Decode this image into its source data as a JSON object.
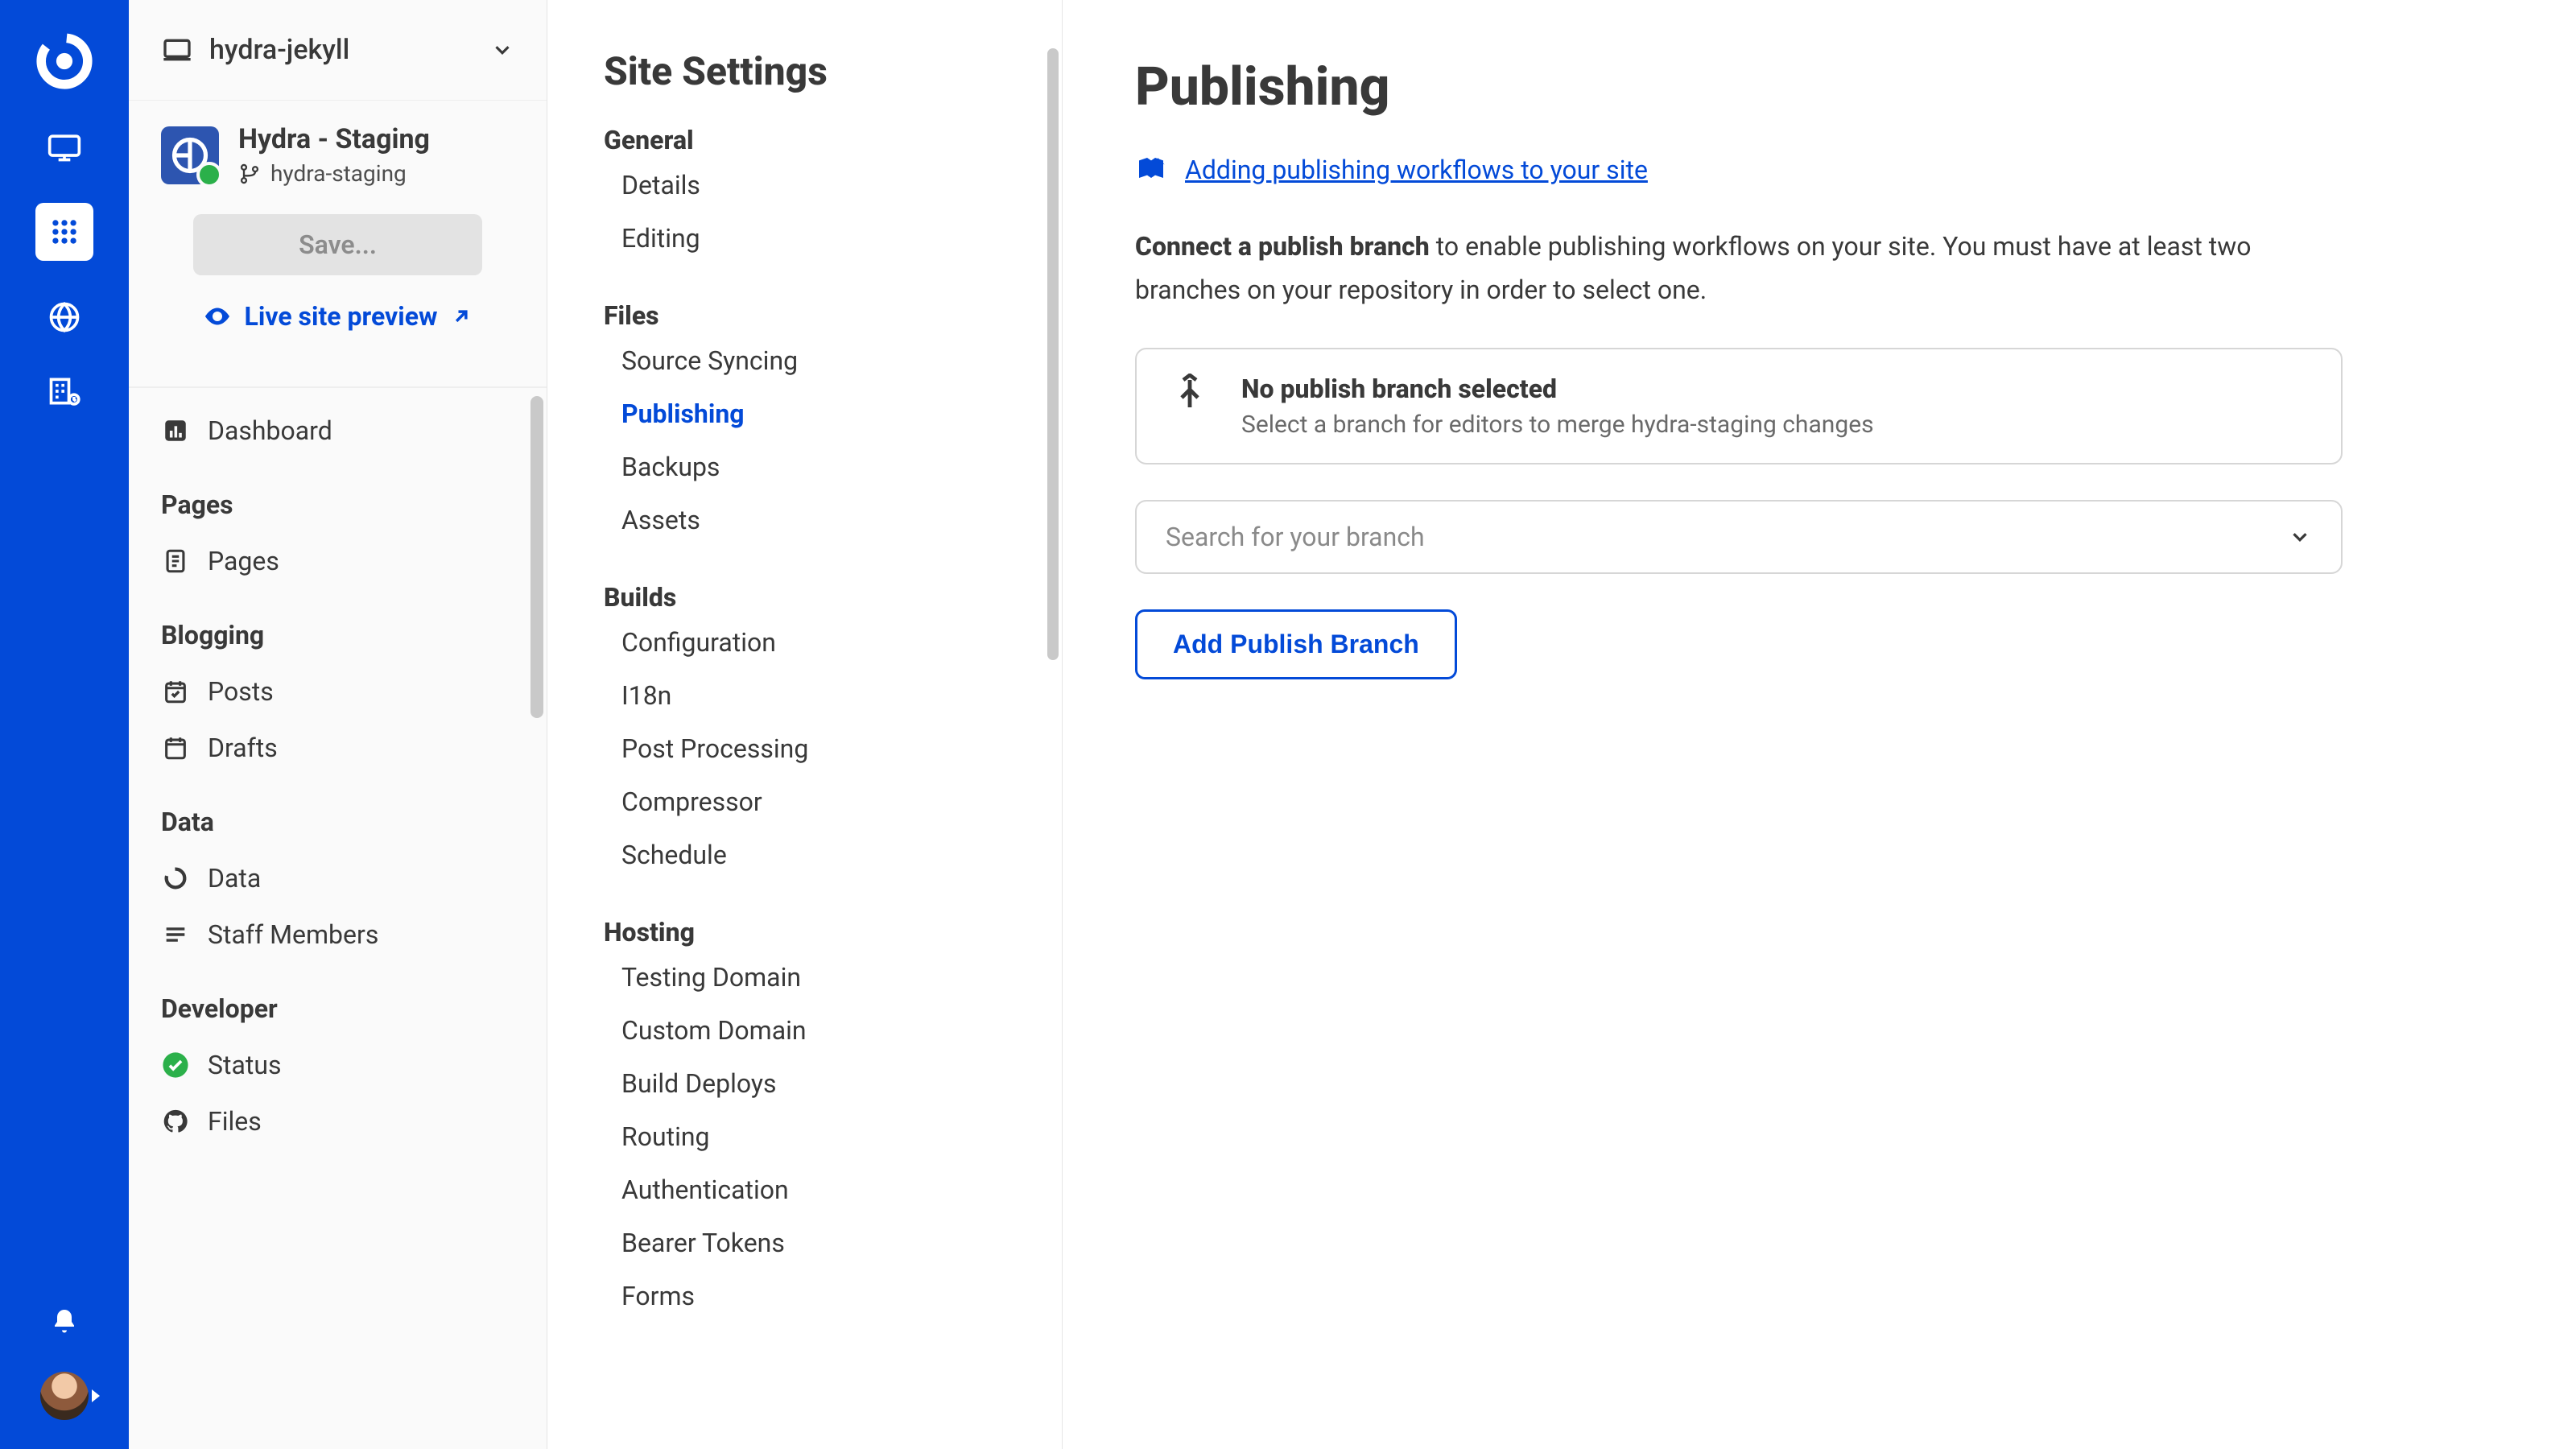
{
  "site_select": {
    "name": "hydra-jekyll"
  },
  "project": {
    "name": "Hydra - Staging",
    "branch": "hydra-staging"
  },
  "actions": {
    "save": "Save...",
    "preview": "Live site preview"
  },
  "sidenav": {
    "dashboard": "Dashboard",
    "groups": [
      {
        "h": "Pages",
        "items": [
          {
            "k": "pages",
            "l": "Pages"
          }
        ]
      },
      {
        "h": "Blogging",
        "items": [
          {
            "k": "posts",
            "l": "Posts"
          },
          {
            "k": "drafts",
            "l": "Drafts"
          }
        ]
      },
      {
        "h": "Data",
        "items": [
          {
            "k": "data",
            "l": "Data"
          },
          {
            "k": "staff",
            "l": "Staff Members"
          }
        ]
      },
      {
        "h": "Developer",
        "items": [
          {
            "k": "status",
            "l": "Status"
          },
          {
            "k": "files",
            "l": "Files"
          }
        ]
      }
    ]
  },
  "settings": {
    "title": "Site Settings",
    "groups": [
      {
        "h": "General",
        "items": [
          "Details",
          "Editing"
        ]
      },
      {
        "h": "Files",
        "items": [
          "Source Syncing",
          "Publishing",
          "Backups",
          "Assets"
        ],
        "active": "Publishing"
      },
      {
        "h": "Builds",
        "items": [
          "Configuration",
          "I18n",
          "Post Processing",
          "Compressor",
          "Schedule"
        ]
      },
      {
        "h": "Hosting",
        "items": [
          "Testing Domain",
          "Custom Domain",
          "Build Deploys",
          "Routing",
          "Authentication",
          "Bearer Tokens",
          "Forms"
        ]
      }
    ]
  },
  "main": {
    "title": "Publishing",
    "doc_link": "Adding publishing workflows to your site",
    "desc_bold": "Connect a publish branch",
    "desc_rest": " to enable publishing workflows on your site. You must have at least two branches on your repository in order to select one.",
    "card_title": "No publish branch selected",
    "card_sub": "Select a branch for editors to merge hydra-staging changes",
    "branch_placeholder": "Search for your branch",
    "add_button": "Add Publish Branch"
  }
}
